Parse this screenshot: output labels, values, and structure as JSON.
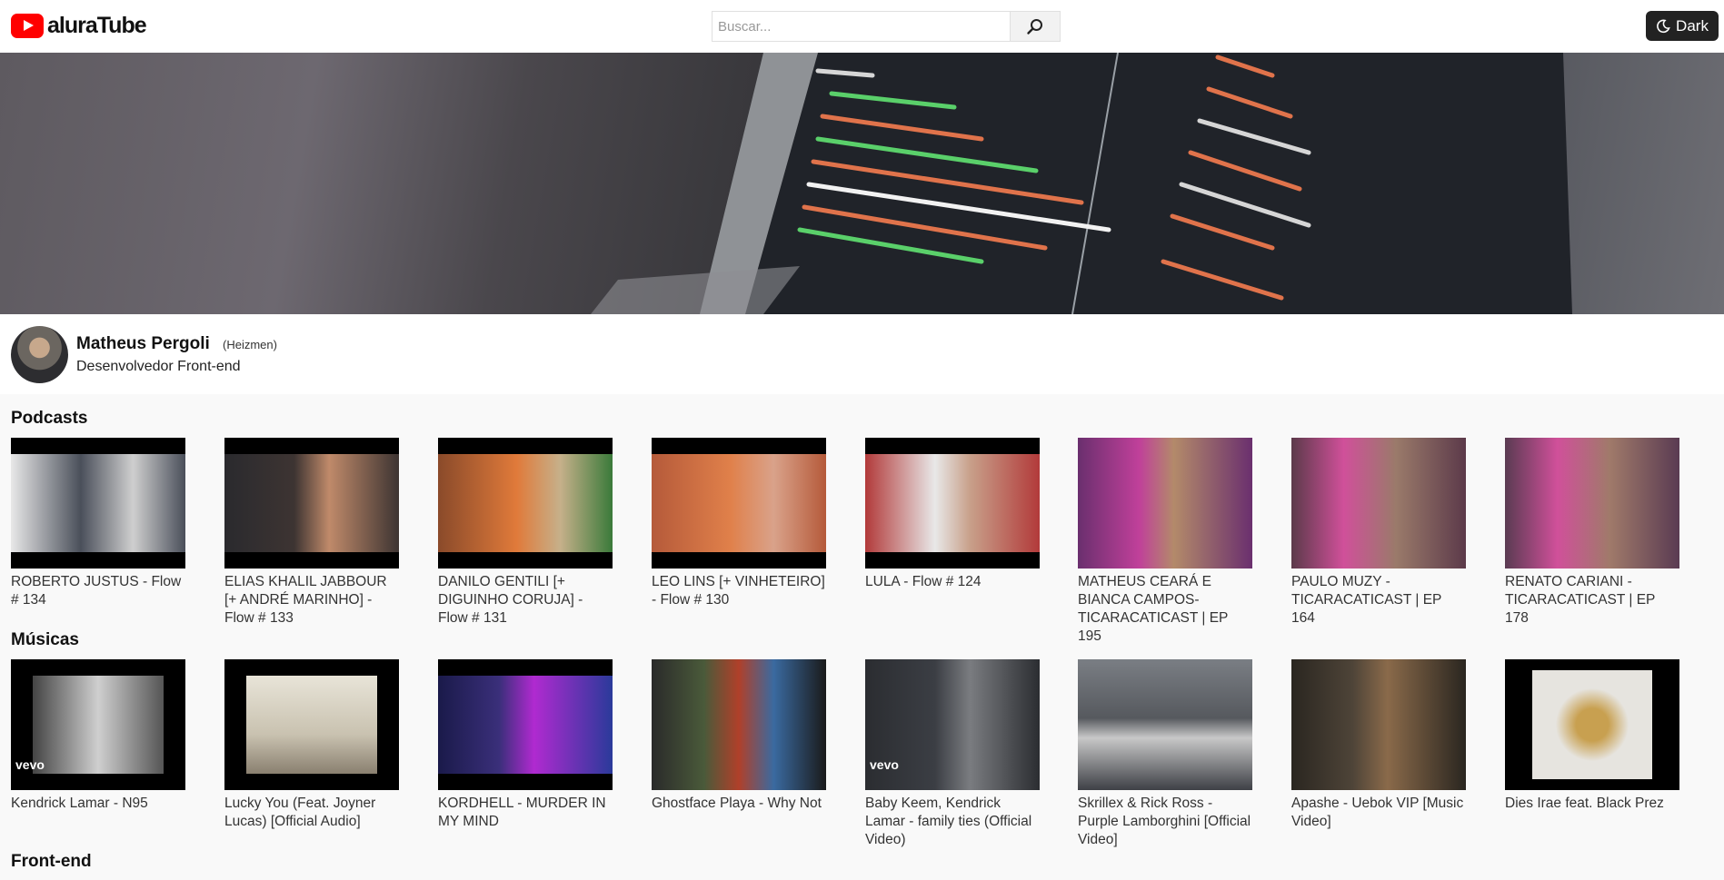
{
  "header": {
    "logo_text": "aluraTube",
    "search_placeholder": "Buscar...",
    "theme_label": "Dark"
  },
  "profile": {
    "name": "Matheus Pergoli",
    "nickname": "(Heizmen)",
    "role": "Desenvolvedor Front-end"
  },
  "sections": [
    {
      "title": "Podcasts",
      "videos": [
        {
          "title": "ROBERTO JUSTUS - Flow # 134",
          "color": "#4a4f5a"
        },
        {
          "title": "ELIAS KHALIL JABBOUR [+ ANDRÉ MARINHO] - Flow # 133",
          "color": "#3d3432"
        },
        {
          "title": "DANILO GENTILI [+ DIGUINHO CORUJA] - Flow # 131",
          "color": "#8a4a2a"
        },
        {
          "title": "LEO LINS [+ VINHETEIRO] - Flow # 130",
          "color": "#b55a3a"
        },
        {
          "title": "LULA - Flow # 124",
          "color": "#b23a3a"
        },
        {
          "title": "MATHEUS CEARÁ E BIANCA CAMPOS- TICARACATICAST | EP 195",
          "color": "#6a2f6e"
        },
        {
          "title": "PAULO MUZY - TICARACATICAST | EP 164",
          "color": "#5c3a4a"
        },
        {
          "title": "RENATO CARIANI - TICARACATICAST | EP 178",
          "color": "#5a3b52"
        }
      ]
    },
    {
      "title": "Músicas",
      "videos": [
        {
          "title": "Kendrick Lamar - N95",
          "color": "#8c8c8c"
        },
        {
          "title": "Lucky You (Feat. Joyner Lucas) [Official Audio]",
          "color": "#c9c2b0"
        },
        {
          "title": "KORDHELL - MURDER IN MY MIND",
          "color": "#3a2f7a"
        },
        {
          "title": "Ghostface Playa - Why Not",
          "color": "#4a5a3a"
        },
        {
          "title": "Baby Keem, Kendrick Lamar - family ties (Official Video)",
          "color": "#3b3e44"
        },
        {
          "title": "Skrillex & Rick Ross - Purple Lamborghini [Official Video]",
          "color": "#56595e"
        },
        {
          "title": "Apashe - Uebok VIP [Music Video]",
          "color": "#4e4438"
        },
        {
          "title": "Dies Irae feat. Black Prez",
          "color": "#e6e4df"
        }
      ]
    },
    {
      "title": "Front-end",
      "videos": []
    }
  ],
  "badges": {
    "vevo": "vevo"
  }
}
